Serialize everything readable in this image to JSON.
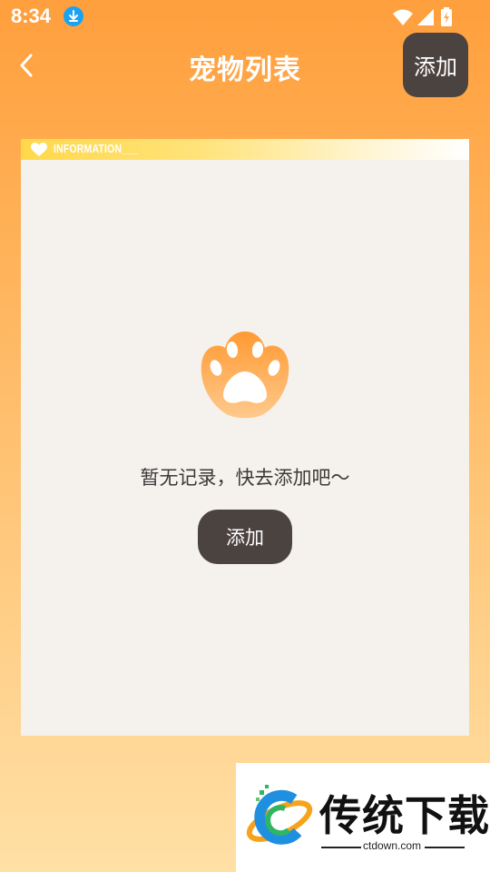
{
  "status_bar": {
    "time": "8:34",
    "icons": [
      "download-badge-icon",
      "wifi-icon",
      "signal-icon",
      "battery-charging-icon"
    ]
  },
  "header": {
    "title": "宠物列表",
    "back_icon": "chevron-left-icon",
    "add_label": "添加"
  },
  "card": {
    "strip_label": "INFORMATION___",
    "strip_icon": "heart-icon",
    "empty_icon": "paw-icon",
    "empty_text": "暂无记录，快去添加吧～",
    "add_label": "添加"
  },
  "watermark": {
    "title": "传统下载",
    "url": "ctdown.com"
  },
  "colors": {
    "bg_top": "#ff9f3d",
    "bg_bottom": "#ffe0a6",
    "button_dark": "#4b4340",
    "card_bg": "#f5f1ed",
    "paw_orange": "#ff9f3d"
  }
}
